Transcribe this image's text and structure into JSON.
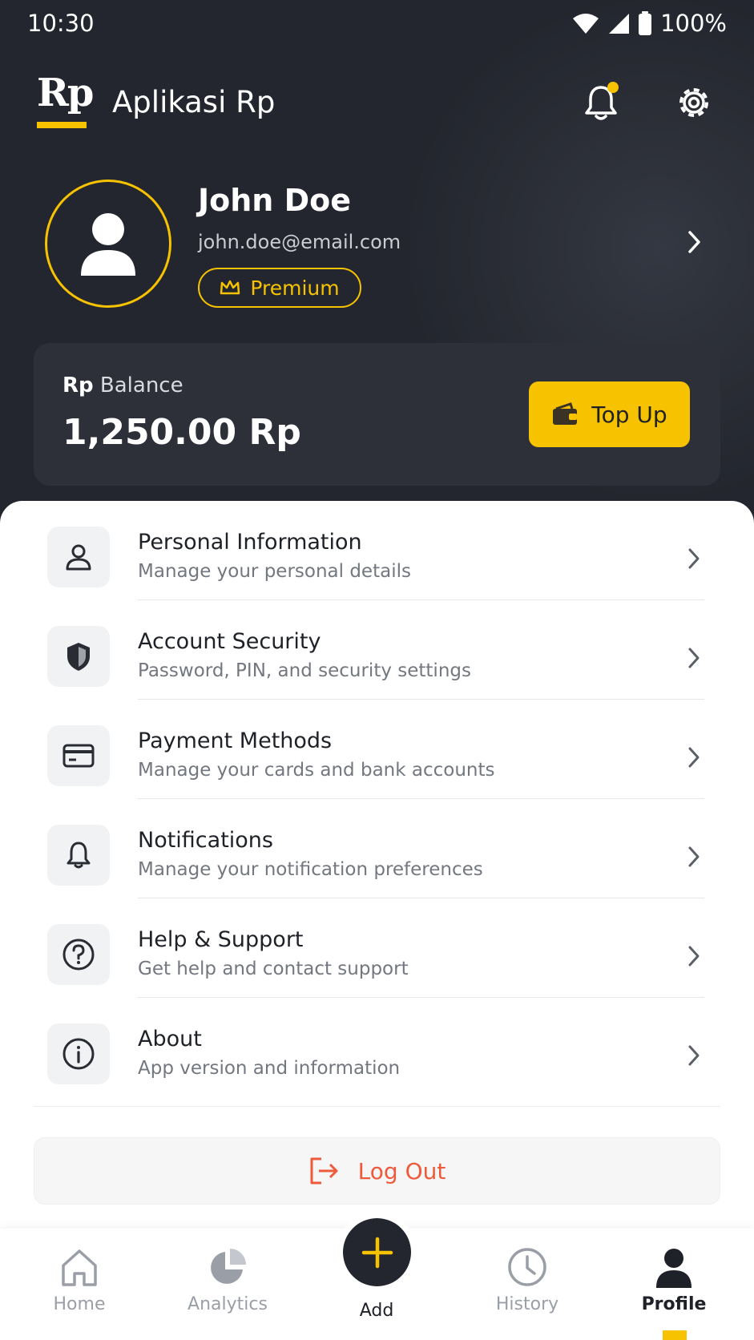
{
  "status_bar": {
    "time": "10:30",
    "battery": "100%"
  },
  "app": {
    "logo": "Rp",
    "title": "Aplikasi Rp",
    "accent": "#f7c200",
    "dark_bg": "#23262e"
  },
  "profile": {
    "name": "John Doe",
    "email": "john.doe@email.com",
    "badge": "Premium"
  },
  "balance": {
    "currency": "Rp",
    "label": "Balance",
    "value": "1,250.00 Rp",
    "topup_label": "Top Up"
  },
  "menu": [
    {
      "title": "Personal Information",
      "subtitle": "Manage your personal details",
      "icon": "user-icon"
    },
    {
      "title": "Account Security",
      "subtitle": "Password, PIN, and security settings",
      "icon": "shield-icon"
    },
    {
      "title": "Payment Methods",
      "subtitle": "Manage your cards and bank accounts",
      "icon": "card-icon"
    },
    {
      "title": "Notifications",
      "subtitle": "Manage your notification preferences",
      "icon": "bell-icon"
    },
    {
      "title": "Help & Support",
      "subtitle": "Get help and contact support",
      "icon": "help-icon"
    },
    {
      "title": "About",
      "subtitle": "App version and information",
      "icon": "info-icon"
    }
  ],
  "logout": {
    "label": "Log Out",
    "color": "#ee5a3a"
  },
  "nav": {
    "home": "Home",
    "analytics": "Analytics",
    "add": "Add",
    "history": "History",
    "profile": "Profile",
    "active": "Profile"
  }
}
